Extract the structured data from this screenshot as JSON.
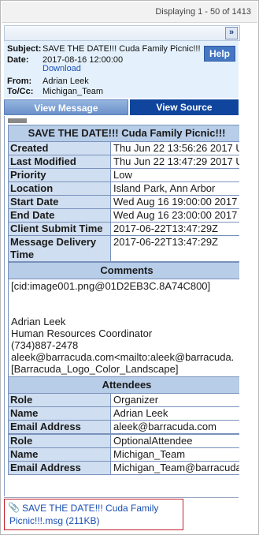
{
  "paging": {
    "text": "Displaying 1 - 50 of 1413"
  },
  "toolbar": {
    "expand_icon": "double-chevron-right-icon",
    "expand_glyph": "»"
  },
  "header": {
    "subject_label": "Subject:",
    "subject": "SAVE THE DATE!!! Cuda Family Picnic!!!",
    "date_label": "Date:",
    "date": "2017-08-16 12:00:00",
    "download": "Download",
    "from_label": "From:",
    "from": "Adrian Leek",
    "tocc_label": "To/Cc:",
    "tocc": "Michigan_Team",
    "help": "Help"
  },
  "tabs": {
    "view_message": "View Message",
    "view_source": "View Source"
  },
  "event": {
    "title": "SAVE THE DATE!!! Cuda Family Picnic!!!",
    "fields": [
      {
        "label": "Created",
        "value": "Thu Jun 22 13:56:26 2017 U"
      },
      {
        "label": "Last Modified",
        "value": "Thu Jun 22 13:47:29 2017 U"
      },
      {
        "label": "Priority",
        "value": "Low"
      },
      {
        "label": "Location",
        "value": "Island Park, Ann Arbor"
      },
      {
        "label": "Start Date",
        "value": "Wed Aug 16 19:00:00 2017"
      },
      {
        "label": "End Date",
        "value": "Wed Aug 16 23:00:00 2017"
      },
      {
        "label": "Client Submit Time",
        "value": "2017-06-22T13:47:29Z"
      },
      {
        "label": "Message Delivery Time",
        "value": "2017-06-22T13:47:29Z"
      }
    ],
    "comments_title": "Comments",
    "comments_lines": [
      "[cid:image001.png@01D2EB3C.8A74C800]",
      "",
      "",
      "Adrian Leek",
      "Human Resources Coordinator",
      "(734)887-2478",
      "aleek@barracuda.com<mailto:aleek@barracuda.",
      "[Barracuda_Logo_Color_Landscape]"
    ],
    "attendees_title": "Attendees",
    "attendees": [
      {
        "role_label": "Role",
        "role": "Organizer",
        "name_label": "Name",
        "name": "Adrian Leek",
        "email_label": "Email Address",
        "email": "aleek@barracuda.com"
      },
      {
        "role_label": "Role",
        "role": "OptionalAttendee",
        "name_label": "Name",
        "name": "Michigan_Team",
        "email_label": "Email Address",
        "email": "Michigan_Team@barracuda."
      }
    ]
  },
  "attachment": {
    "icon": "paperclip-icon",
    "label": "SAVE THE DATE!!! Cuda Family Picnic!!!.msg (211KB)"
  }
}
